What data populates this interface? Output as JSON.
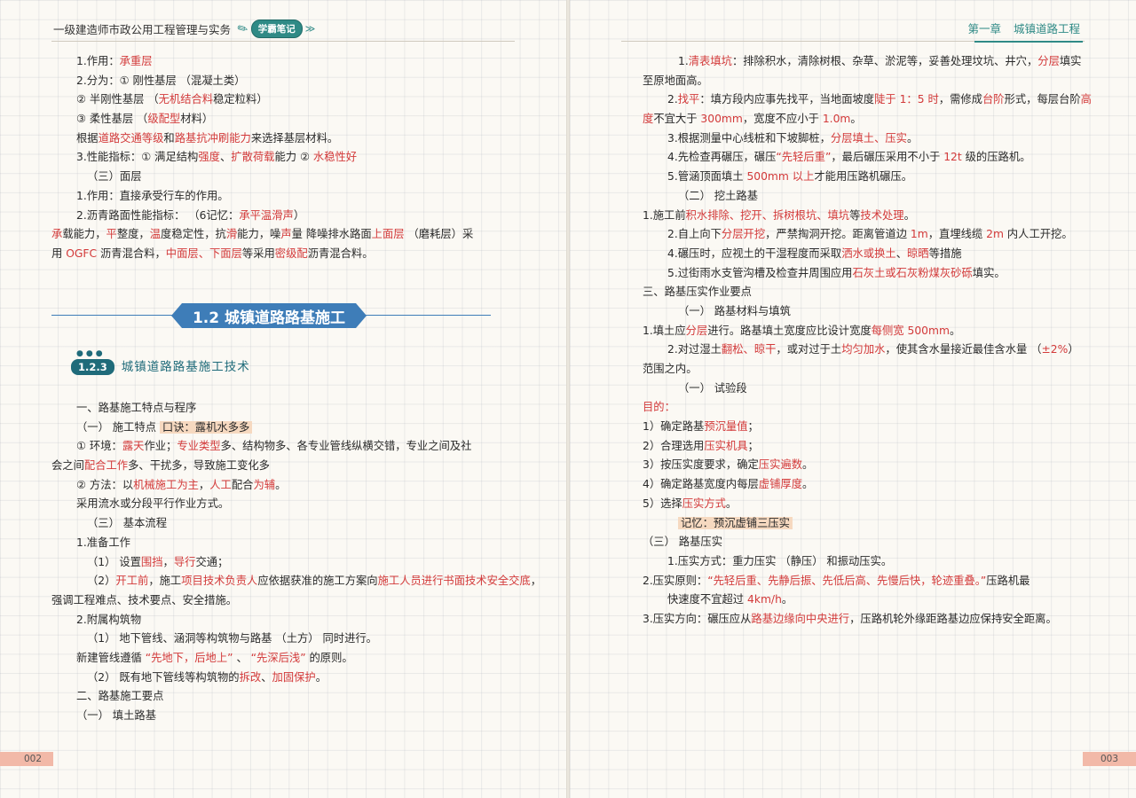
{
  "header": {
    "book_title": "一级建造师市政公用工程管理与实务",
    "badge": "学霸笔记",
    "badge_arrows": "≫",
    "chapter": "第一章",
    "chapter_title": "城镇道路工程"
  },
  "section": {
    "title": "1.2 城镇道路路基施工"
  },
  "subsection": {
    "number": "1.2.3",
    "title": "城镇道路路基施工技术"
  },
  "left_top_lines": [
    [
      {
        "t": "1.作用：",
        "c": ""
      },
      {
        "t": "承重层",
        "c": "r"
      }
    ],
    [
      {
        "t": "2.分为：① 刚性基层 （混凝土类）",
        "c": ""
      }
    ],
    [
      {
        "t": "② 半刚性基层 （",
        "c": ""
      },
      {
        "t": "无机结合料",
        "c": "r"
      },
      {
        "t": "稳定粒料）",
        "c": ""
      }
    ],
    [
      {
        "t": "③ 柔性基层 （",
        "c": ""
      },
      {
        "t": "级配型",
        "c": "r"
      },
      {
        "t": "材料）",
        "c": ""
      }
    ],
    [
      {
        "t": "根据",
        "c": ""
      },
      {
        "t": "道路交通等级",
        "c": "r"
      },
      {
        "t": "和",
        "c": ""
      },
      {
        "t": "路基抗冲刷能力",
        "c": "r"
      },
      {
        "t": "来选择基层材料。",
        "c": ""
      }
    ],
    [
      {
        "t": "3.性能指标：① 满足结构",
        "c": ""
      },
      {
        "t": "强度",
        "c": "r"
      },
      {
        "t": "、",
        "c": ""
      },
      {
        "t": "扩散荷载",
        "c": "r"
      },
      {
        "t": "能力 ② ",
        "c": ""
      },
      {
        "t": "水稳性好",
        "c": "r"
      }
    ],
    [
      {
        "t": "（三）面层",
        "c": ""
      }
    ],
    [
      {
        "t": "1.作用：直接承受行车的作用。",
        "c": ""
      }
    ],
    [
      {
        "t": "2.沥青路面性能指标：  （6记忆：",
        "c": ""
      },
      {
        "t": "承平温滑声",
        "c": "r"
      },
      {
        "t": "）",
        "c": ""
      }
    ],
    [
      {
        "t": "承",
        "c": "r"
      },
      {
        "t": "载能力，",
        "c": ""
      },
      {
        "t": "平",
        "c": "r"
      },
      {
        "t": "整度，",
        "c": ""
      },
      {
        "t": "温",
        "c": "r"
      },
      {
        "t": "度稳定性，抗",
        "c": ""
      },
      {
        "t": "滑",
        "c": "r"
      },
      {
        "t": "能力，噪",
        "c": ""
      },
      {
        "t": "声",
        "c": "r"
      },
      {
        "t": "量 降噪排水路面",
        "c": ""
      },
      {
        "t": "上面层",
        "c": "r"
      },
      {
        "t": " （磨耗层）采",
        "c": ""
      }
    ],
    [
      {
        "t": "用 ",
        "c": ""
      },
      {
        "t": "OGFC",
        "c": "r"
      },
      {
        "t": " 沥青混合料，",
        "c": ""
      },
      {
        "t": "中面层、下面层",
        "c": "r"
      },
      {
        "t": "等采用",
        "c": ""
      },
      {
        "t": "密级配",
        "c": "r"
      },
      {
        "t": "沥青混合料。",
        "c": ""
      }
    ]
  ],
  "left_bottom_lines": [
    [
      {
        "t": "一、路基施工特点与程序",
        "c": ""
      }
    ],
    [
      {
        "t": "（一） 施工特点                      ",
        "c": ""
      },
      {
        "t": "口诀：露机水多多",
        "c": "hl"
      }
    ],
    [
      {
        "t": "① 环境：",
        "c": ""
      },
      {
        "t": "露天",
        "c": "r"
      },
      {
        "t": "作业；",
        "c": ""
      },
      {
        "t": "专业类型",
        "c": "r"
      },
      {
        "t": "多、结构物多、各专业管线纵横交错，专业之间及社",
        "c": ""
      }
    ],
    [
      {
        "t": "会之间",
        "c": ""
      },
      {
        "t": "配合工作",
        "c": "r"
      },
      {
        "t": "多、干扰多，导致施工变化多",
        "c": ""
      }
    ],
    [
      {
        "t": "② 方法：以",
        "c": ""
      },
      {
        "t": "机械施工为主",
        "c": "r"
      },
      {
        "t": "，",
        "c": ""
      },
      {
        "t": "人工",
        "c": "r"
      },
      {
        "t": "配合",
        "c": ""
      },
      {
        "t": "为辅",
        "c": "r"
      },
      {
        "t": "。",
        "c": ""
      }
    ],
    [
      {
        "t": "采用流水或分段平行作业方式。",
        "c": ""
      }
    ],
    [
      {
        "t": "（三） 基本流程",
        "c": ""
      }
    ],
    [
      {
        "t": "1.准备工作",
        "c": ""
      }
    ],
    [
      {
        "t": "（1） 设置",
        "c": ""
      },
      {
        "t": "围挡",
        "c": "r"
      },
      {
        "t": "，",
        "c": ""
      },
      {
        "t": "导行",
        "c": "r"
      },
      {
        "t": "交通；",
        "c": ""
      }
    ],
    [
      {
        "t": "（2）",
        "c": ""
      },
      {
        "t": "开工前",
        "c": "r"
      },
      {
        "t": "，施工",
        "c": ""
      },
      {
        "t": "项目技术负责人",
        "c": "r"
      },
      {
        "t": "应依据获准的施工方案向",
        "c": ""
      },
      {
        "t": "施工人员进行书面技术安全交底",
        "c": "r"
      },
      {
        "t": "，",
        "c": ""
      }
    ],
    [
      {
        "t": "强调工程难点、技术要点、安全措施。",
        "c": ""
      }
    ],
    [
      {
        "t": "2.附属构筑物",
        "c": ""
      }
    ],
    [
      {
        "t": "（1） 地下管线、涵洞等构筑物与路基 （土方） 同时进行。",
        "c": ""
      }
    ],
    [
      {
        "t": "新建管线遵循 ",
        "c": ""
      },
      {
        "t": "“先地下，后地上”",
        "c": "r"
      },
      {
        "t": " 、 ",
        "c": ""
      },
      {
        "t": "“先深后浅”",
        "c": "r"
      },
      {
        "t": " 的原则。",
        "c": ""
      }
    ],
    [
      {
        "t": "（2） 既有地下管线等构筑物的",
        "c": ""
      },
      {
        "t": "拆改",
        "c": "r"
      },
      {
        "t": "、",
        "c": ""
      },
      {
        "t": "加固保护",
        "c": "r"
      },
      {
        "t": "。",
        "c": ""
      }
    ],
    [
      {
        "t": "二、路基施工要点",
        "c": ""
      }
    ],
    [
      {
        "t": "（一） 填土路基",
        "c": ""
      }
    ]
  ],
  "right_lines": [
    [
      {
        "t": "1.",
        "c": ""
      },
      {
        "t": "清表填坑",
        "c": "r"
      },
      {
        "t": "：排除积水，清除树根、杂草、淤泥等，妥善处理坟坑、井穴，",
        "c": ""
      },
      {
        "t": "分层",
        "c": "r"
      },
      {
        "t": "填实",
        "c": ""
      }
    ],
    [
      {
        "t": "至原地面高。",
        "c": ""
      }
    ],
    [
      {
        "t": "2.",
        "c": ""
      },
      {
        "t": "找平",
        "c": "r"
      },
      {
        "t": "：填方段内应事先找平，当地面坡度",
        "c": ""
      },
      {
        "t": "陡于 1：5 时",
        "c": "r"
      },
      {
        "t": "，需修成",
        "c": ""
      },
      {
        "t": "台阶",
        "c": "r"
      },
      {
        "t": "形式，每层台阶",
        "c": ""
      },
      {
        "t": "高",
        "c": "r"
      }
    ],
    [
      {
        "t": "度",
        "c": "r"
      },
      {
        "t": "不宜大于 ",
        "c": ""
      },
      {
        "t": "300mm",
        "c": "r"
      },
      {
        "t": "，宽度不应小于 ",
        "c": ""
      },
      {
        "t": "1.0m",
        "c": "r"
      },
      {
        "t": "。",
        "c": ""
      }
    ],
    [
      {
        "t": "3.根据测量中心线桩和下坡脚桩，",
        "c": ""
      },
      {
        "t": "分层填土、压实",
        "c": "r"
      },
      {
        "t": "。",
        "c": ""
      }
    ],
    [
      {
        "t": "4.先检查再碾压，碾压",
        "c": ""
      },
      {
        "t": "“先轻后重”",
        "c": "r"
      },
      {
        "t": "，最后碾压采用不小于 ",
        "c": ""
      },
      {
        "t": "12t",
        "c": "r"
      },
      {
        "t": " 级的压路机。",
        "c": ""
      }
    ],
    [
      {
        "t": "5.管涵顶面填土 ",
        "c": ""
      },
      {
        "t": "500mm 以上",
        "c": "r"
      },
      {
        "t": "才能用压路机碾压。",
        "c": ""
      }
    ],
    [
      {
        "t": "（二） 挖土路基",
        "c": ""
      }
    ],
    [
      {
        "t": "1.施工前",
        "c": ""
      },
      {
        "t": "积水排除、挖开、拆树根坑、填坑",
        "c": "r"
      },
      {
        "t": "等",
        "c": ""
      },
      {
        "t": "技术处理",
        "c": "r"
      },
      {
        "t": "。",
        "c": ""
      }
    ],
    [
      {
        "t": "2.自上向下",
        "c": ""
      },
      {
        "t": "分层开挖",
        "c": "r"
      },
      {
        "t": "，严禁掏洞开挖。距离管道边 ",
        "c": ""
      },
      {
        "t": "1m",
        "c": "r"
      },
      {
        "t": "，直埋线缆 ",
        "c": ""
      },
      {
        "t": "2m",
        "c": "r"
      },
      {
        "t": " 内人工开挖。",
        "c": ""
      }
    ],
    [
      {
        "t": "4.碾压时，应视土的干湿程度而采取",
        "c": ""
      },
      {
        "t": "洒水或换土",
        "c": "r"
      },
      {
        "t": "、",
        "c": ""
      },
      {
        "t": "晾晒",
        "c": "r"
      },
      {
        "t": "等措施",
        "c": ""
      }
    ],
    [
      {
        "t": "5.过街雨水支管沟槽及检查井周围应用",
        "c": ""
      },
      {
        "t": "石灰土或石灰粉煤灰砂砾",
        "c": "r"
      },
      {
        "t": "填实。",
        "c": ""
      }
    ],
    [
      {
        "t": "三、路基压实作业要点",
        "c": ""
      }
    ],
    [
      {
        "t": "（一） 路基材料与填筑",
        "c": ""
      }
    ],
    [
      {
        "t": "1.填土应",
        "c": ""
      },
      {
        "t": "分层",
        "c": "r"
      },
      {
        "t": "进行。路基填土宽度应比设计宽度",
        "c": ""
      },
      {
        "t": "每侧宽 500mm",
        "c": "r"
      },
      {
        "t": "。",
        "c": ""
      }
    ],
    [
      {
        "t": "2.对过湿土",
        "c": ""
      },
      {
        "t": "翻松、晾干",
        "c": "r"
      },
      {
        "t": "，或对过于土",
        "c": ""
      },
      {
        "t": "均匀加水",
        "c": "r"
      },
      {
        "t": "，使其含水量接近最佳含水量 （",
        "c": ""
      },
      {
        "t": "±2%",
        "c": "r"
      },
      {
        "t": "）",
        "c": ""
      }
    ],
    [
      {
        "t": "范围之内。",
        "c": ""
      }
    ],
    [
      {
        "t": "（一） 试验段",
        "c": ""
      }
    ],
    [
      {
        "t": "目的：",
        "c": "r"
      }
    ],
    [
      {
        "t": "1）确定路基",
        "c": ""
      },
      {
        "t": "预沉量值",
        "c": "r"
      },
      {
        "t": "；",
        "c": ""
      }
    ],
    [
      {
        "t": "2）合理选用",
        "c": ""
      },
      {
        "t": "压实机具",
        "c": "r"
      },
      {
        "t": "；",
        "c": ""
      }
    ],
    [
      {
        "t": "3）按压实度要求，确定",
        "c": ""
      },
      {
        "t": "压实遍数",
        "c": "r"
      },
      {
        "t": "。",
        "c": ""
      }
    ],
    [
      {
        "t": "4）确定路基宽度内每层",
        "c": ""
      },
      {
        "t": "虚铺厚度",
        "c": "r"
      },
      {
        "t": "。",
        "c": ""
      }
    ],
    [
      {
        "t": "5）选择",
        "c": ""
      },
      {
        "t": "压实方式",
        "c": "r"
      },
      {
        "t": "。",
        "c": ""
      }
    ],
    [
      {
        "t": "记忆：预沉虚铺三压实",
        "c": "hl"
      }
    ],
    [
      {
        "t": "（三） 路基压实",
        "c": ""
      }
    ],
    [
      {
        "t": "1.压实方式：重力压实 （静压） 和振动压实。",
        "c": ""
      }
    ],
    [
      {
        "t": "2.压实原则：",
        "c": ""
      },
      {
        "t": "“先轻后重、先静后振、先低后高、先慢后快，轮迹重叠。”",
        "c": "r"
      },
      {
        "t": "压路机最",
        "c": ""
      }
    ],
    [
      {
        "t": "快速度不宜超过 ",
        "c": ""
      },
      {
        "t": "4km/h",
        "c": "r"
      },
      {
        "t": "。",
        "c": ""
      }
    ],
    [
      {
        "t": "3.压实方向：碾压应从",
        "c": ""
      },
      {
        "t": "路基边缘向中央进行",
        "c": "r"
      },
      {
        "t": "，压路机轮外缘距路基边应保持安全距离。",
        "c": ""
      }
    ]
  ],
  "page_numbers": {
    "left": "002",
    "right": "003"
  }
}
